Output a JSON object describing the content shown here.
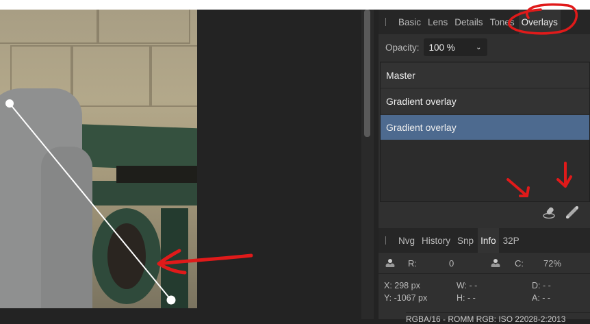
{
  "top_tabs": [
    "Basic",
    "Lens",
    "Details",
    "Tones",
    "Overlays"
  ],
  "active_top_tab": "Overlays",
  "opacity": {
    "label": "Opacity:",
    "value": "100 %"
  },
  "overlays": [
    "Master",
    "Gradient overlay",
    "Gradient overlay"
  ],
  "selected_overlay_index": 2,
  "tools": [
    "brush-overlay-icon",
    "gradient-overlay-icon"
  ],
  "bottom_tabs": [
    "Nvg",
    "History",
    "Snp",
    "Info",
    "32P"
  ],
  "active_bottom_tab": "Info",
  "info": {
    "r_label": "R:",
    "r_value": "0",
    "c_label": "C:",
    "c_value": "72%",
    "x": "X: 298 px",
    "y": "Y: -1067 px",
    "w": "W: - -",
    "h": "H: - -",
    "d": "D: - -",
    "a": "A: - -"
  },
  "status": "RGBA/16 - ROMM RGB: ISO 22028-2:2013",
  "colors": {
    "selected": "#4d6a8f",
    "annotation": "#e01a1a"
  }
}
